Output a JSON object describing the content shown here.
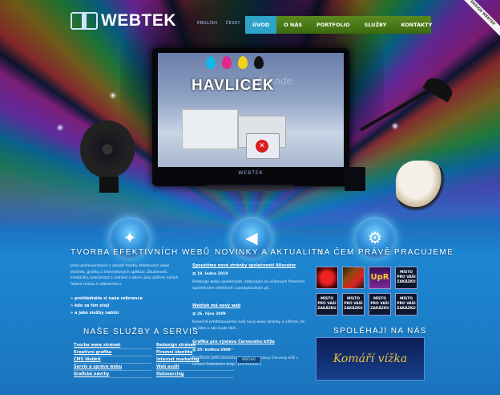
{
  "header": {
    "logo": "WEBTEK",
    "lang": [
      "ENGLISH",
      "ČESKY"
    ],
    "nav": [
      "ÚVOD",
      "O NÁS",
      "PORTFOLIO",
      "SLUŽBY",
      "KONTAKTY"
    ],
    "ribbon": "DESIGN WEBTEK"
  },
  "hero": {
    "brand": "HAVLICEK",
    "watermark": "ďily-nde",
    "monitor_label": "WEBTEK"
  },
  "efekt": {
    "title": "TVORBA EFEKTIVNÍCH WEBŮ",
    "text": "Jsme profesionálové v oblasti tvorby efektivních www stránek, grafiky a internetových aplikací. Zkušenosti, kreativita, preciznost a rozhled v oboru jsou pilířem našich řešení cestou k zákazníkovi.",
    "links": [
      "prohlédněte si naše reference",
      "kdo za tím stojí",
      "a jaké služby nabízí"
    ]
  },
  "services": {
    "title": "NAŠE SLUŽBY A SERVIS",
    "items": [
      "Tvorba www stránek",
      "Redesign stránek",
      "Kreativní grafika",
      "Firemní identita",
      "CMS Webkit",
      "Internet marketing",
      "Servis a správa webu",
      "Web audit",
      "Grafické návrhy",
      "Outsourcing"
    ]
  },
  "news": {
    "title": "NOVINKY A AKTUALITY",
    "items": [
      {
        "title": "Spouštíme nové stránky společnosti Allocator",
        "date": "19. ledna 2010",
        "text": "Redesign webu společnosti, zabývající se účelovým firemním spolehlivém efektivně a poskytováním př..."
      },
      {
        "title": "Webtek má nový web",
        "date": "26. října 2009",
        "text": "Konečně představujeme svůj nový www stránky a věříme, že se Vám u nás bude líbit..."
      },
      {
        "title": "Grafika pro výstavu Červeného kříže",
        "date": "25. května 2009",
        "text": "Navštivte jistě slavnostní zahájení výstavy Červený kříž v historii Ústeckého kraje, pro litoraru j..."
      }
    ],
    "archive": "ARCHIV"
  },
  "working": {
    "title": "NA ČEM PRÁVĚ PRACUJEME",
    "cell_text": "MÍSTO PRO VAŠI ZAKÁZKU",
    "upr": "UpR"
  },
  "partners": {
    "title": "SPOLÉHAJÍ NA NÁS",
    "banner": "Komáří vížka"
  }
}
